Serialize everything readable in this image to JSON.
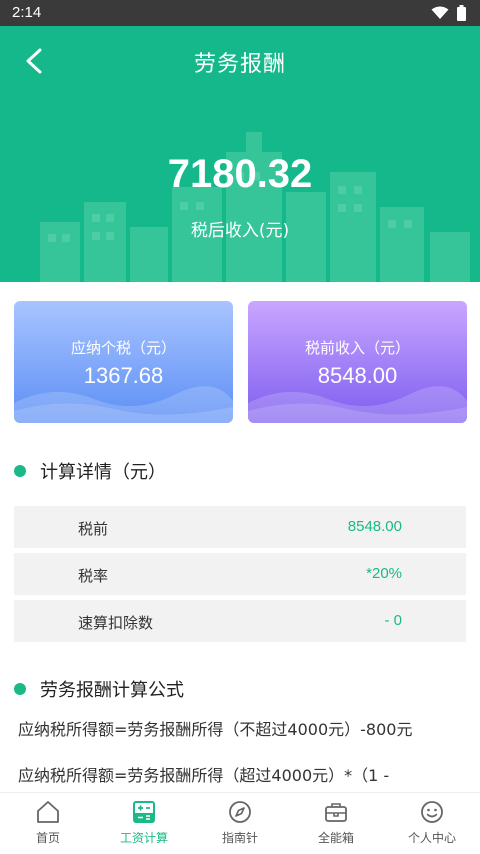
{
  "status_bar": {
    "time": "2:14"
  },
  "header": {
    "title": "劳务报酬",
    "back_icon": "chevron-left-icon"
  },
  "hero": {
    "amount": "7180.32",
    "amount_label": "税后收入(元)"
  },
  "cards": [
    {
      "label": "应纳个税（元）",
      "value": "1367.68"
    },
    {
      "label": "税前收入（元）",
      "value": "8548.00"
    }
  ],
  "details": {
    "title": "计算详情（元）",
    "rows": [
      {
        "label": "税前",
        "value": "8548.00"
      },
      {
        "label": "税率",
        "value": "*20%"
      },
      {
        "label": "速算扣除数",
        "value": "- 0"
      }
    ]
  },
  "formula": {
    "title": "劳务报酬计算公式",
    "lines": [
      "应纳税所得额=劳务报酬所得（不超过4000元）-800元",
      "应纳税所得额=劳务报酬所得（超过4000元）*（1 -"
    ]
  },
  "tabbar": {
    "items": [
      {
        "label": "首页",
        "icon": "home-icon"
      },
      {
        "label": "工资计算",
        "icon": "calculator-icon",
        "active": true
      },
      {
        "label": "指南针",
        "icon": "compass-icon"
      },
      {
        "label": "全能箱",
        "icon": "toolbox-icon"
      },
      {
        "label": "个人中心",
        "icon": "smiley-icon"
      }
    ]
  },
  "colors": {
    "primary": "#1ab987",
    "hero_bg": "#14b88a",
    "card_blue": "#5c8ff5",
    "card_purple": "#7e5ef0"
  }
}
